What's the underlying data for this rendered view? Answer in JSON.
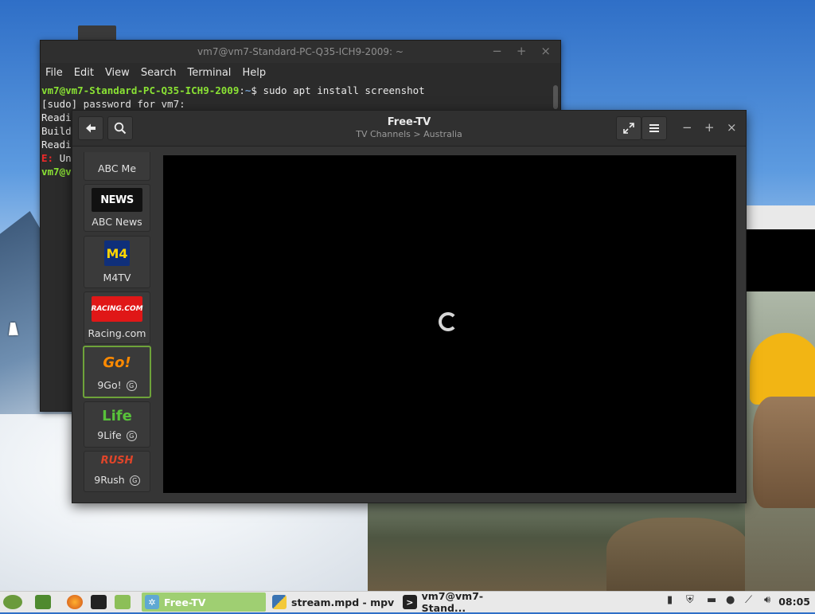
{
  "terminal": {
    "title": "vm7@vm7-Standard-PC-Q35-ICH9-2009: ~",
    "menu": [
      "File",
      "Edit",
      "View",
      "Search",
      "Terminal",
      "Help"
    ],
    "prompt_user": "vm7@vm7-Standard-PC-Q35-ICH9-2009",
    "prompt_sep": ":",
    "prompt_path": "~",
    "prompt_end": "$ ",
    "command": "sudo apt install screenshot",
    "lines": [
      "[sudo] password for vm7:",
      "Readi",
      "Build",
      "Readi"
    ],
    "error_prefix": "E:",
    "error_rest": " Un",
    "last_prompt": "vm7@v",
    "controls": [
      "−",
      "+",
      "×"
    ]
  },
  "freetv": {
    "title": "Free-TV",
    "subtitle": "TV Channels > Australia",
    "controls": [
      "−",
      "+",
      "×"
    ],
    "channels": [
      {
        "label": "ABC Me",
        "logo": ""
      },
      {
        "label": "ABC News",
        "logo": "NEWS"
      },
      {
        "label": "M4TV",
        "logo": "M4"
      },
      {
        "label": "Racing.com",
        "logo": "RACING.COM"
      },
      {
        "label": "9Go!",
        "logo": "Go!",
        "badge": "G"
      },
      {
        "label": "9Life",
        "logo": "Life",
        "badge": "G"
      },
      {
        "label": "9Rush",
        "logo": "RUSH",
        "badge": "G"
      }
    ]
  },
  "taskbar": {
    "tasks": [
      {
        "label": "Free-TV",
        "icon": "freetv-icon"
      },
      {
        "label": "stream.mpd - mpv",
        "icon": "python-icon"
      },
      {
        "label": "vm7@vm7-Stand...",
        "icon": "terminal-icon"
      }
    ],
    "clock": "08:05"
  }
}
